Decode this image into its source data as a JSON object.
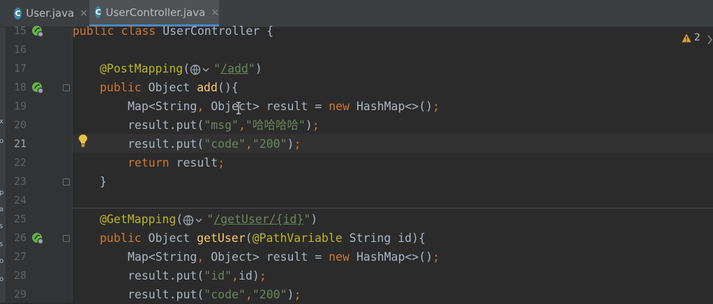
{
  "tabs": [
    {
      "icon": "C",
      "label": "User.java",
      "close": "×"
    },
    {
      "icon": "C",
      "label": "UserController.java",
      "close": "×"
    }
  ],
  "line_numbers": [
    "15",
    "16",
    "17",
    "18",
    "19",
    "20",
    "21",
    "22",
    "23",
    "24",
    "25",
    "26",
    "27",
    "28",
    "29"
  ],
  "warnings": {
    "count": "2",
    "icon": "warning-icon"
  },
  "code": {
    "l15": {
      "kw1": "public",
      "kw2": "class",
      "rest": " UserController {"
    },
    "l17": {
      "ann": "@PostMapping",
      "open": "(",
      "q1": "\"",
      "url": "/add",
      "q2": "\"",
      "close": ")"
    },
    "l18": {
      "kw1": "public",
      "t1": " Object ",
      "fn": "add",
      "rest": "(){"
    },
    "l19": {
      "t1": "Map<String",
      "c1": ",",
      "t2": " Object> result = ",
      "kw": "new",
      "t3": " HashMap<>()",
      "semi": ";"
    },
    "l20": {
      "t1": "result.put(",
      "s1": "\"msg\"",
      "c1": ",",
      "s2": "\"哈哈哈哈\"",
      "t2": ")",
      "semi": ";"
    },
    "l21": {
      "t1": "result.put(",
      "s1": "\"code\"",
      "c1": ",",
      "s2": "\"200\"",
      "t2": ")",
      "semi": ";"
    },
    "l22": {
      "kw": "return",
      "t1": " result",
      "semi": ";"
    },
    "l23": {
      "t1": "}"
    },
    "l25": {
      "ann": "@GetMapping",
      "open": "(",
      "q1": "\"",
      "url": "/getUser/{id}",
      "q2": "\"",
      "close": ")"
    },
    "l26": {
      "kw1": "public",
      "t1": " Object ",
      "fn": "getUser",
      "t2": "(",
      "ann": "@PathVariable",
      "t3": " String id){"
    },
    "l27": {
      "t1": "Map<String",
      "c1": ",",
      "t2": " Object> result = ",
      "kw": "new",
      "t3": " HashMap<>()",
      "semi": ";"
    },
    "l28": {
      "t1": "result.put(",
      "s1": "\"id\"",
      "c1": ",",
      "t2": "id)",
      "semi": ";"
    },
    "l29": {
      "t1": "result.put(",
      "s1": "\"code\"",
      "c1": ",",
      "s2": "\"200\"",
      "t2": ")",
      "semi": ";"
    }
  },
  "colors": {
    "editor_bg": "#2b2b2b",
    "keyword": "#cc7832",
    "annotation": "#bbb529",
    "string": "#6a8759",
    "function": "#ffc66d",
    "text": "#a9b7c6"
  },
  "strip_chars": [
    "x",
    "o",
    "p",
    "a",
    "s",
    "s",
    "o",
    "o"
  ]
}
